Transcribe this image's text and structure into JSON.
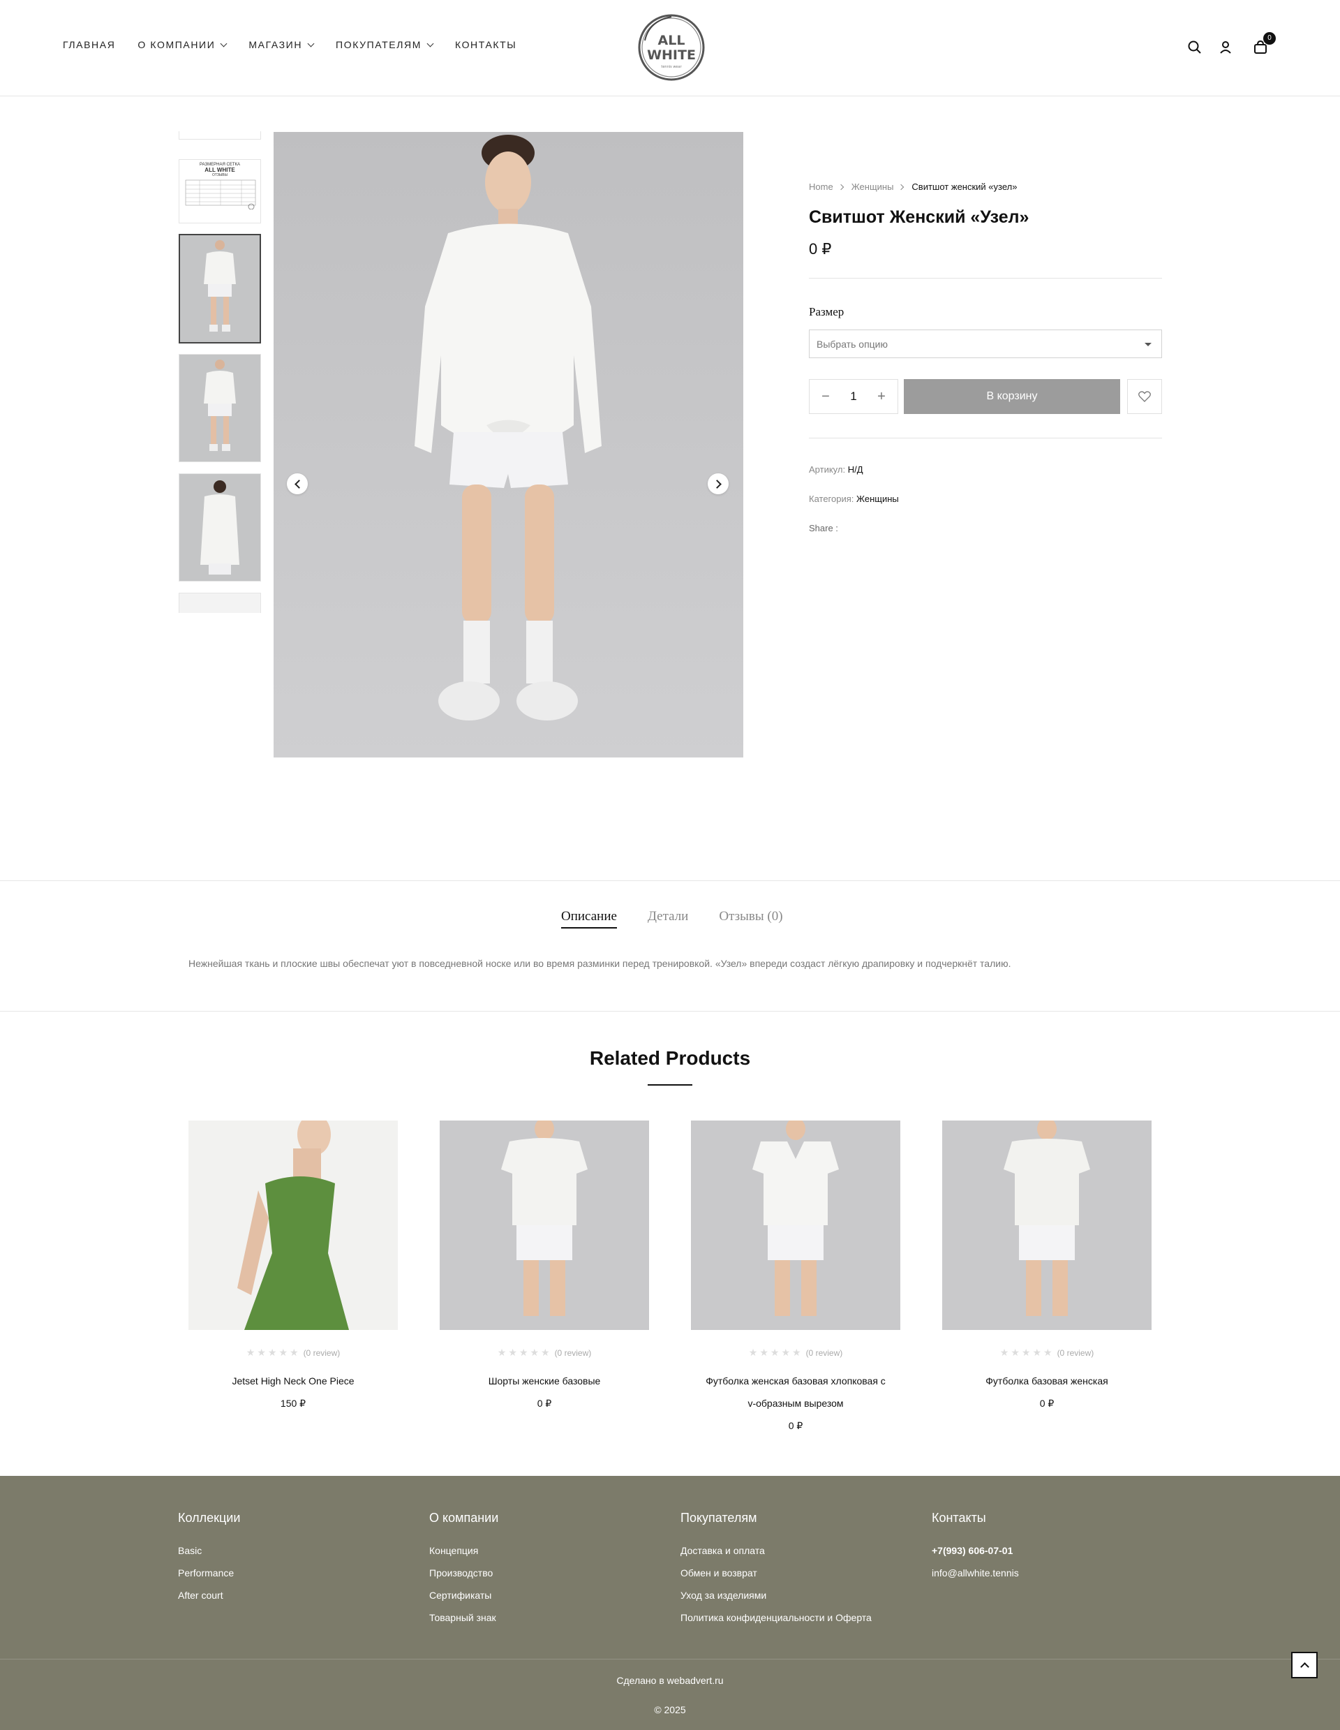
{
  "nav": {
    "items": [
      {
        "label": "ГЛАВНАЯ",
        "has_dropdown": false
      },
      {
        "label": "О КОМПАНИИ",
        "has_dropdown": true
      },
      {
        "label": "МАГАЗИН",
        "has_dropdown": true
      },
      {
        "label": "ПОКУПАТЕЛЯМ",
        "has_dropdown": true
      },
      {
        "label": "КОНТАКТЫ",
        "has_dropdown": false
      }
    ]
  },
  "logo": {
    "line1": "ALL",
    "line2": "WHITE",
    "tagline": "tennis wear"
  },
  "header": {
    "cart_count": "0"
  },
  "size_chart_thumb": {
    "title": "РАЗМЕРНАЯ СЕТКА",
    "brand": "ALL WHITE",
    "sub": "ОТЗЫВЫ"
  },
  "product": {
    "breadcrumb": [
      "Home",
      "Женщины",
      "Свитшот женский «узел»"
    ],
    "title": "Свитшот Женский «Узел»",
    "price": "0 ₽",
    "size_label": "Размер",
    "size_placeholder": "Выбрать опцию",
    "quantity": "1",
    "add_to_cart": "В корзину",
    "sku_label": "Артикул:",
    "sku_value": "Н/Д",
    "category_label": "Категория:",
    "category_value": "Женщины",
    "share_label": "Share :"
  },
  "tabs": {
    "items": [
      "Описание",
      "Детали",
      "Отзывы (0)"
    ],
    "active": 0,
    "description": "Нежнейшая ткань и плоские швы обеспечат уют в повседневной носке или во время разминки перед тренировкой. «Узел»  впереди создаст лёгкую драпировку и подчеркнёт талию."
  },
  "related": {
    "title": "Related Products",
    "products": [
      {
        "name": "Jetset High Neck One Piece",
        "price": "150 ₽",
        "reviews": "(0 review)"
      },
      {
        "name": "Шорты женские базовые",
        "price": "0 ₽",
        "reviews": "(0 review)"
      },
      {
        "name": "Футболка женская базовая хлопковая с v-образным вырезом",
        "price": "0 ₽",
        "reviews": "(0 review)"
      },
      {
        "name": "Футболка базовая женская",
        "price": "0 ₽",
        "reviews": "(0 review)"
      }
    ]
  },
  "footer": {
    "columns": [
      {
        "title": "Коллекции",
        "links": [
          "Basic",
          "Performance",
          "After court"
        ]
      },
      {
        "title": "О компании",
        "links": [
          "Концепция",
          "Производство",
          "Сертификаты",
          "Товарный знак"
        ]
      },
      {
        "title": "Покупателям",
        "links": [
          "Доставка и оплата",
          "Обмен и возврат",
          "Уход за изделиями",
          "Политика конфиденциальности и Оферта"
        ]
      },
      {
        "title": "Контакты",
        "links": [
          "+7(993) 606-07-01",
          "info@allwhite.tennis"
        ]
      }
    ],
    "made_by": "Сделано в webadvert.ru",
    "copyright": "© 2025"
  },
  "colors": {
    "footer_bg": "#7c7b6a",
    "cart_button": "#9c9c9c",
    "swimsuit": "#5d8f3e"
  }
}
